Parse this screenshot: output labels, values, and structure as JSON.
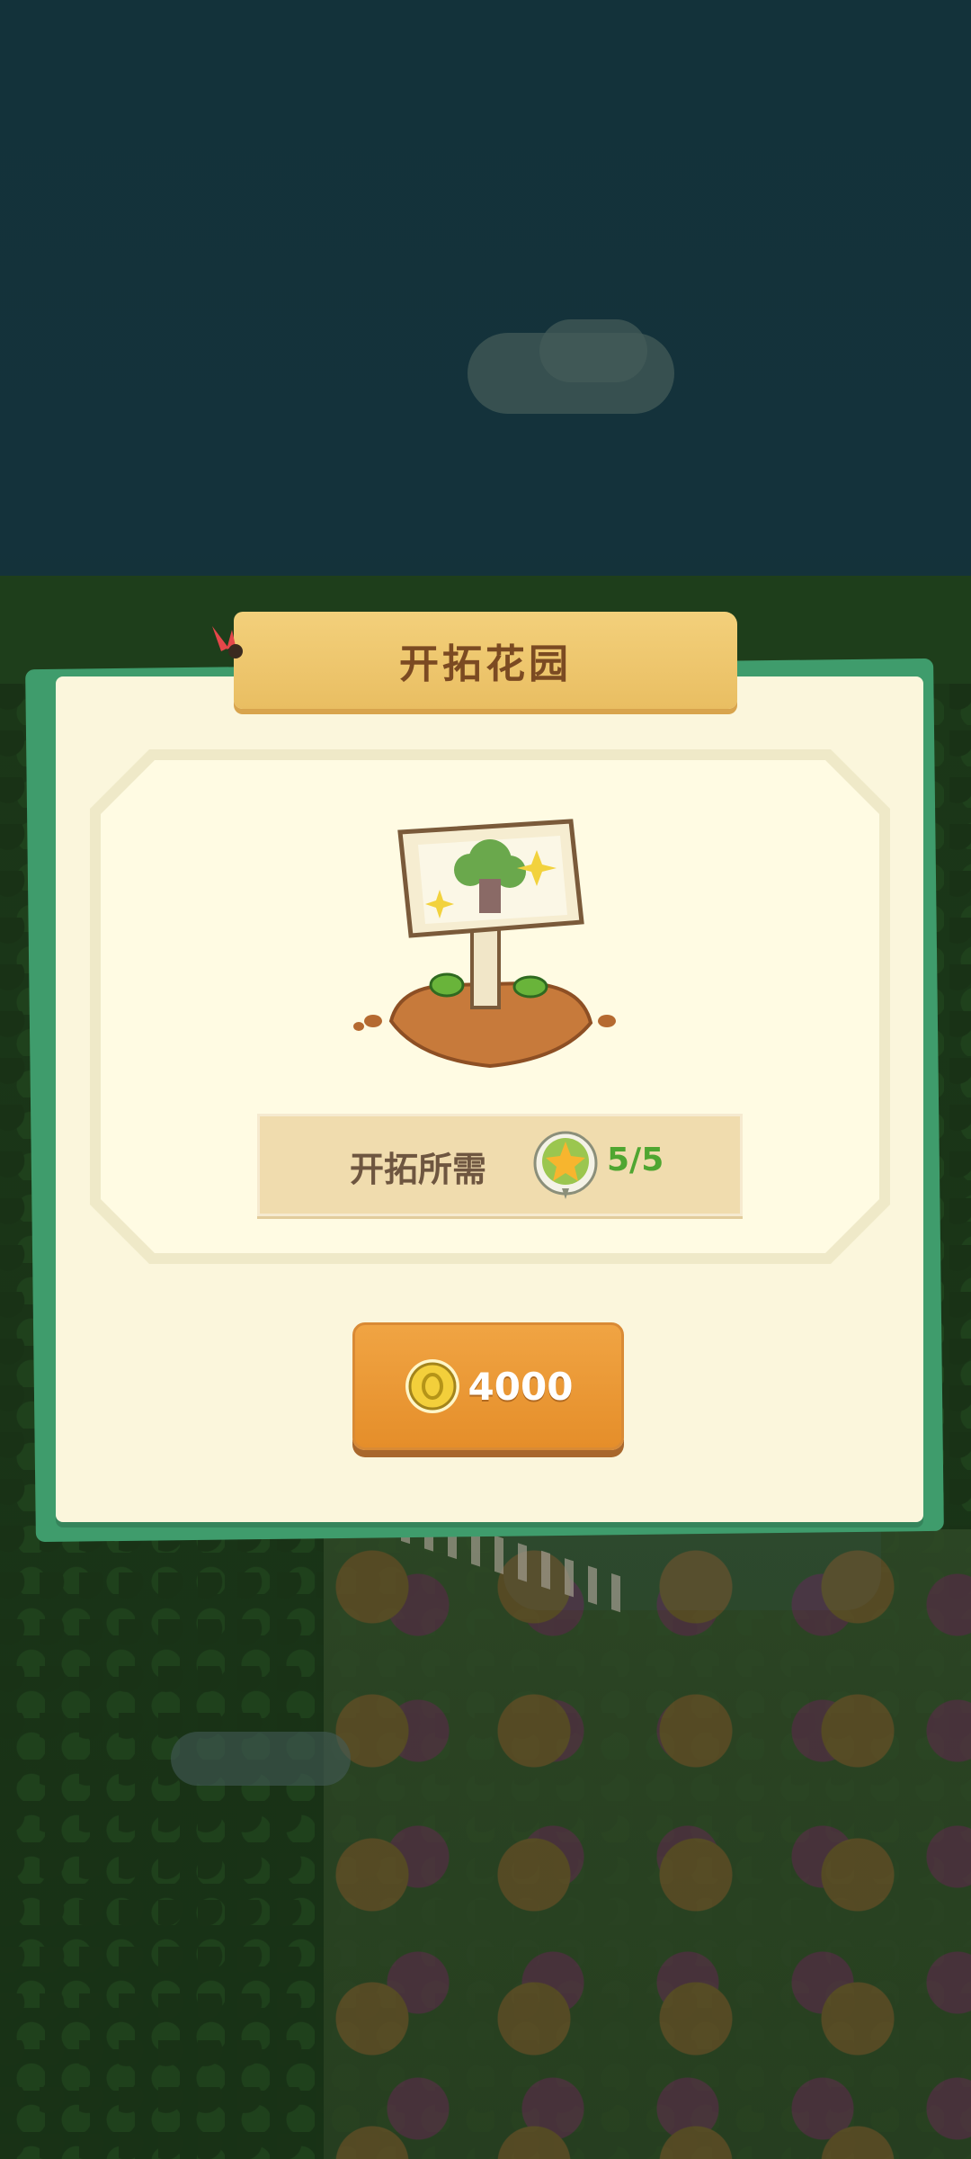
{
  "dialog": {
    "title": "开拓花园",
    "requirement_label": "开拓所需",
    "requirement_count": "5/5",
    "price": "4000"
  },
  "icons": {
    "requirement": "star-flower-icon",
    "currency": "gold-coin-icon",
    "illustration": "garden-signpost-illustration"
  },
  "colors": {
    "accent_button": "#e58e2a",
    "title_ribbon": "#efc36a",
    "count_green": "#4fa631"
  }
}
